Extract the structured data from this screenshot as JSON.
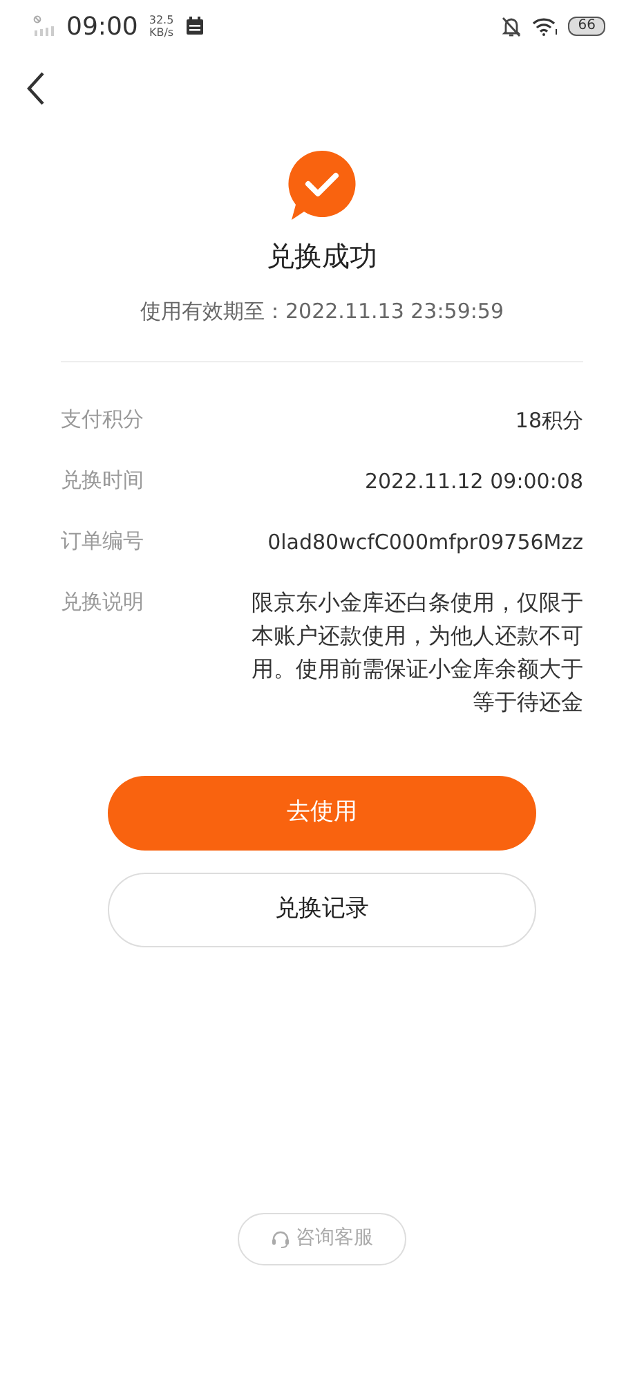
{
  "status_bar": {
    "time": "09:00",
    "speed_value": "32.5",
    "speed_unit": "KB/s",
    "battery": "66"
  },
  "result": {
    "title": "兑换成功",
    "validity": "使用有效期至：2022.11.13 23:59:59"
  },
  "details": [
    {
      "label": "支付积分",
      "value": "18积分"
    },
    {
      "label": "兑换时间",
      "value": "2022.11.12 09:00:08"
    },
    {
      "label": "订单编号",
      "value": "0lad80wcfC000mfpr09756Mzz"
    },
    {
      "label": "兑换说明",
      "value": "限京东小金库还白条使用，仅限于本账户还款使用，为他人还款不可用。使用前需保证小金库余额大于等于待还金"
    }
  ],
  "buttons": [
    {
      "label": "去使用",
      "kind": "primary"
    },
    {
      "label": "兑换记录",
      "kind": "outline"
    }
  ],
  "service_button": {
    "label": "咨询客服"
  }
}
